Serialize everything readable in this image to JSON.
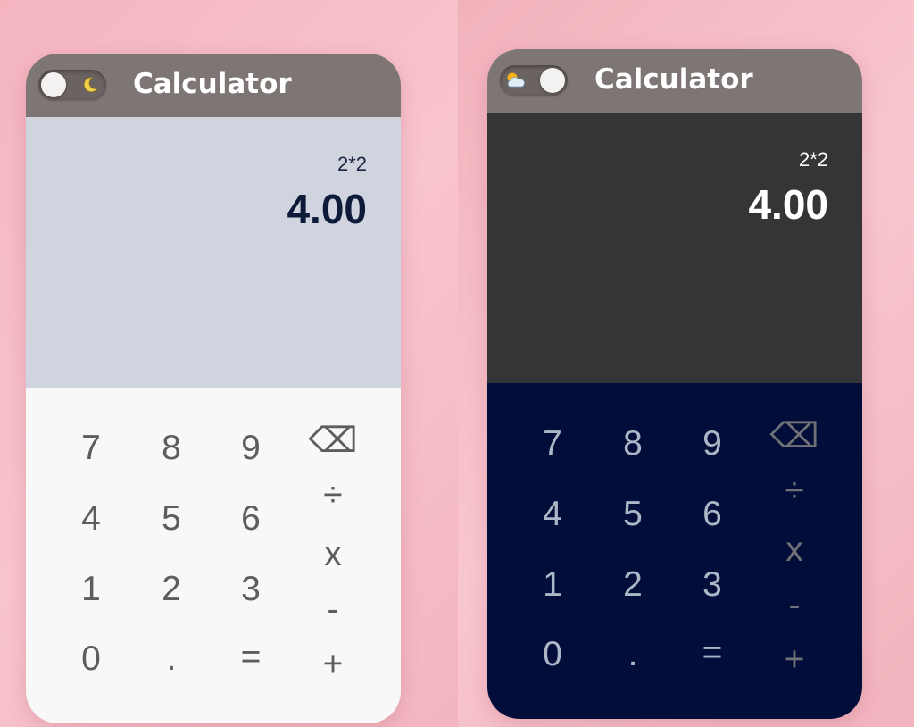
{
  "light": {
    "header": {
      "title": "Calculator"
    },
    "theme_toggle": {
      "icon": "moon-icon",
      "mode": "light"
    },
    "display": {
      "expression": "2*2",
      "result": "4.00"
    },
    "keys": {
      "seven": "7",
      "eight": "8",
      "nine": "9",
      "backspace": "⌫",
      "four": "4",
      "five": "5",
      "six": "6",
      "divide": "÷",
      "one": "1",
      "two": "2",
      "three": "3",
      "multiply": "x",
      "zero": "0",
      "decimal": ".",
      "equals": "=",
      "subtract": "-",
      "add": "+"
    }
  },
  "dark": {
    "header": {
      "title": "Calculator"
    },
    "theme_toggle": {
      "icon": "sun-cloud-icon",
      "mode": "dark"
    },
    "display": {
      "expression": "2*2",
      "result": "4.00"
    },
    "keys": {
      "seven": "7",
      "eight": "8",
      "nine": "9",
      "backspace": "⌫",
      "four": "4",
      "five": "5",
      "six": "6",
      "divide": "÷",
      "one": "1",
      "two": "2",
      "three": "3",
      "multiply": "x",
      "zero": "0",
      "decimal": ".",
      "equals": "=",
      "subtract": "-",
      "add": "+"
    }
  },
  "colors": {
    "header": "#7d7674",
    "light_display": "#d0d4df",
    "light_keypad": "#f8f8f8",
    "dark_display": "#353436",
    "dark_keypad": "#020d39",
    "background": "#f6bec7"
  }
}
